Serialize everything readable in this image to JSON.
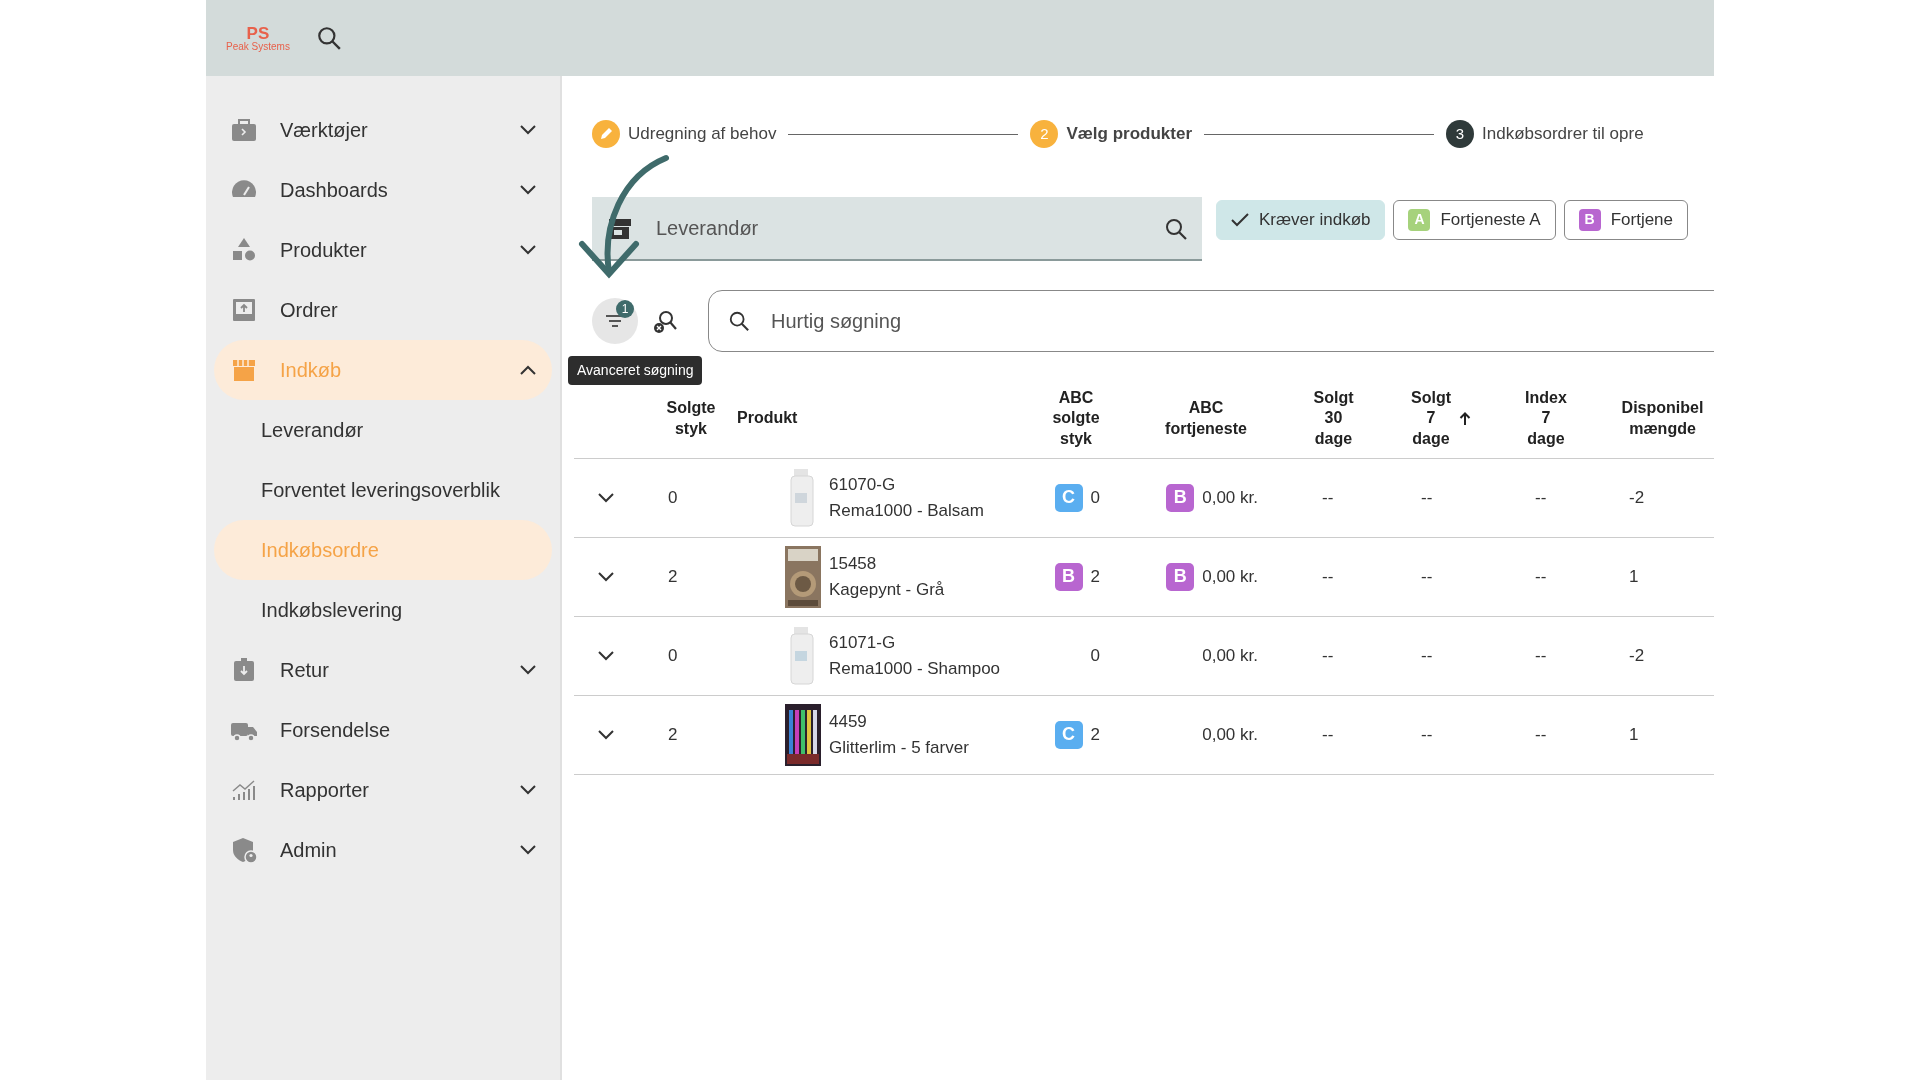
{
  "header": {
    "logo": {
      "mark": "PS",
      "text": "Peak Systems"
    }
  },
  "sidebar": {
    "items": [
      {
        "label": "Værktøjer",
        "kind": "group",
        "expanded": false,
        "selected": false
      },
      {
        "label": "Dashboards",
        "kind": "group",
        "expanded": false,
        "selected": false
      },
      {
        "label": "Produkter",
        "kind": "group",
        "expanded": false,
        "selected": false
      },
      {
        "label": "Ordrer",
        "kind": "link",
        "selected": false
      },
      {
        "label": "Indkøb",
        "kind": "group",
        "expanded": true,
        "selected": true,
        "children": [
          {
            "label": "Leverandør",
            "selected": false
          },
          {
            "label": "Forventet leveringsoverblik",
            "selected": false
          },
          {
            "label": "Indkøbsordre",
            "selected": true
          },
          {
            "label": "Indkøbslevering",
            "selected": false
          }
        ]
      },
      {
        "label": "Retur",
        "kind": "group",
        "expanded": false,
        "selected": false
      },
      {
        "label": "Forsendelse",
        "kind": "link",
        "selected": false
      },
      {
        "label": "Rapporter",
        "kind": "group",
        "expanded": false,
        "selected": false
      },
      {
        "label": "Admin",
        "kind": "group",
        "expanded": false,
        "selected": false
      }
    ]
  },
  "stepper": {
    "steps": [
      {
        "label": "Udregning af behov",
        "completed": true,
        "selected": false
      },
      {
        "label": "Vælg produkter",
        "completed": false,
        "selected": true,
        "number": "2"
      },
      {
        "label": "Indkøbsordrer til opre",
        "completed": false,
        "selected": false,
        "number": "3"
      }
    ]
  },
  "supplier_field": {
    "placeholder": "Leverandør"
  },
  "filter_chips": [
    {
      "label": "Kræver indkøb",
      "selected": true
    },
    {
      "label": "Fortjeneste A",
      "badge": "A",
      "color": "#a6d27c",
      "selected": false
    },
    {
      "label": "Fortjene",
      "badge": "B",
      "color": "#b866d0",
      "selected": false
    }
  ],
  "toolbar": {
    "filter_count": "1",
    "tooltip": "Avanceret søgning"
  },
  "quick_search": {
    "placeholder": "Hurtig søgning"
  },
  "table": {
    "columns": [
      {
        "lines": [
          "Solgte",
          "styk"
        ],
        "sorted": false
      },
      {
        "lines": [
          "Produkt"
        ],
        "sorted": false
      },
      {
        "lines": [
          "ABC",
          "solgte",
          "styk"
        ],
        "sorted": false
      },
      {
        "lines": [
          "ABC",
          "fortjeneste"
        ],
        "sorted": false
      },
      {
        "lines": [
          "Solgt",
          "30",
          "dage"
        ],
        "sorted": false
      },
      {
        "lines": [
          "Solgt",
          "7",
          "dage"
        ],
        "sorted": true
      },
      {
        "lines": [
          "Index",
          "7",
          "dage"
        ],
        "sorted": false
      },
      {
        "lines": [
          "Disponibel",
          "mængde"
        ],
        "sorted": false
      }
    ],
    "rows": [
      {
        "expanded": false,
        "sold": "0",
        "code": "61070-G",
        "name": "Rema1000 - Balsam",
        "abc_sold": {
          "grade": "C",
          "color": "#5aaef0"
        },
        "sold_count": "0",
        "abc_profit": {
          "grade": "B",
          "color": "#b866d0"
        },
        "profit": "0,00 kr.",
        "sold_30": "--",
        "sold_7": "--",
        "index_7": "--",
        "available": "-2"
      },
      {
        "expanded": false,
        "sold": "2",
        "code": "15458",
        "name": "Kagepynt - Grå",
        "abc_sold": {
          "grade": "B",
          "color": "#b866d0"
        },
        "sold_count": "2",
        "abc_profit": {
          "grade": "B",
          "color": "#b866d0"
        },
        "profit": "0,00 kr.",
        "sold_30": "--",
        "sold_7": "--",
        "index_7": "--",
        "available": "1"
      },
      {
        "expanded": false,
        "sold": "0",
        "code": "61071-G",
        "name": "Rema1000 - Shampoo",
        "sold_count": "0",
        "profit": "0,00 kr.",
        "sold_30": "--",
        "sold_7": "--",
        "index_7": "--",
        "available": "-2"
      },
      {
        "expanded": false,
        "sold": "2",
        "code": "4459",
        "name": "Glitterlim - 5 farver",
        "abc_sold": {
          "grade": "C",
          "color": "#5aaef0"
        },
        "sold_count": "2",
        "profit": "0,00 kr.",
        "sold_30": "--",
        "sold_7": "--",
        "index_7": "--",
        "available": "1"
      }
    ]
  }
}
